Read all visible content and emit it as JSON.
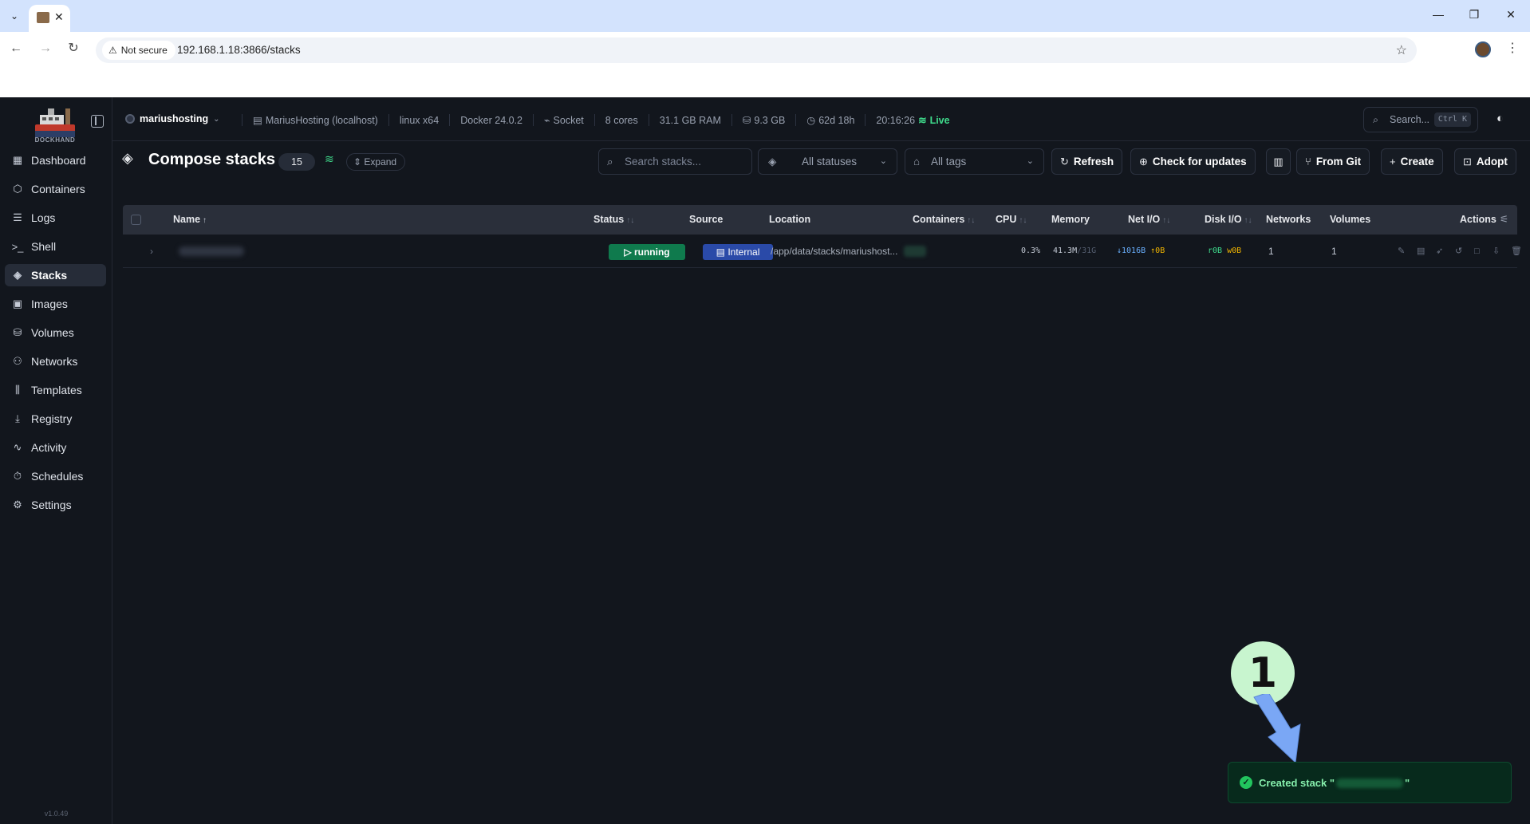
{
  "browser": {
    "security_label": "Not secure",
    "url": "192.168.1.18:3866/stacks"
  },
  "sidebar": {
    "logo_text": "DOCKHAND",
    "items": [
      {
        "label": "Dashboard",
        "icon": "dashboard-icon"
      },
      {
        "label": "Containers",
        "icon": "box-icon"
      },
      {
        "label": "Logs",
        "icon": "logs-icon"
      },
      {
        "label": "Shell",
        "icon": "terminal-icon"
      },
      {
        "label": "Stacks",
        "icon": "layers-icon",
        "active": true
      },
      {
        "label": "Images",
        "icon": "images-icon"
      },
      {
        "label": "Volumes",
        "icon": "database-icon"
      },
      {
        "label": "Networks",
        "icon": "network-icon"
      },
      {
        "label": "Templates",
        "icon": "library-icon"
      },
      {
        "label": "Registry",
        "icon": "download-icon"
      },
      {
        "label": "Activity",
        "icon": "activity-icon"
      },
      {
        "label": "Schedules",
        "icon": "timer-icon"
      },
      {
        "label": "Settings",
        "icon": "gear-icon"
      }
    ],
    "version": "v1.0.49"
  },
  "topbar": {
    "environment": "mariushosting",
    "host": "MariusHosting (localhost)",
    "platform": "linux x64",
    "docker": "Docker 24.0.2",
    "connection": "Socket",
    "cores": "8 cores",
    "ram": "31.1 GB RAM",
    "disk": "9.3 GB",
    "uptime": "62d 18h",
    "time": "20:16:26",
    "live": "Live",
    "search_placeholder": "Search...",
    "search_shortcut": "Ctrl K"
  },
  "page": {
    "title": "Compose stacks",
    "count": "15",
    "expand_label": "Expand",
    "search_placeholder": "Search stacks...",
    "status_filter": "All statuses",
    "tags_filter": "All tags",
    "buttons": {
      "refresh": "Refresh",
      "check_updates": "Check for updates",
      "from_git": "From Git",
      "create": "Create",
      "adopt": "Adopt"
    }
  },
  "table": {
    "columns": {
      "name": "Name",
      "status": "Status",
      "source": "Source",
      "location": "Location",
      "containers": "Containers",
      "cpu": "CPU",
      "memory": "Memory",
      "net_io": "Net I/O",
      "disk_io": "Disk I/O",
      "networks": "Networks",
      "volumes": "Volumes",
      "actions": "Actions"
    },
    "rows": [
      {
        "status": "running",
        "source": "Internal",
        "location": "/app/data/stacks/mariushost...",
        "cpu": "0.3%",
        "memory_used": "41.3M",
        "memory_total": "/31G",
        "net_down": "↓1016B",
        "net_up": "↑0B",
        "disk_read": "r0B",
        "disk_write": "w0B",
        "networks": "1",
        "volumes": "1"
      }
    ]
  },
  "annotation": {
    "number": "1"
  },
  "toast": {
    "prefix": "Created stack \"",
    "suffix": "\""
  },
  "colors": {
    "app_bg": "#12161d",
    "accent_green": "#3fdb8c",
    "running": "#0f7a4d",
    "internal": "#2a4aa8",
    "toast_bg": "#072a1c"
  }
}
